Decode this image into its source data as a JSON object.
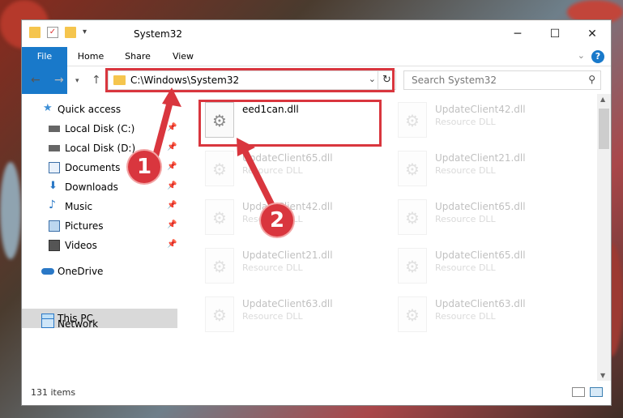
{
  "window": {
    "title": "System32",
    "controls": {
      "minimize": "─",
      "maximize": "☐",
      "close": "✕"
    }
  },
  "ribbon": {
    "tabs": [
      "File",
      "Home",
      "Share",
      "View"
    ],
    "help": "?"
  },
  "address": {
    "path": "C:\\Windows\\System32",
    "search_placeholder": "Search System32"
  },
  "sidebar": {
    "items": [
      {
        "label": "Quick access",
        "icon": "star-icon",
        "pinned": false
      },
      {
        "label": "Local Disk (C:)",
        "icon": "drive-icon",
        "pinned": true
      },
      {
        "label": "Local Disk (D:)",
        "icon": "drive-icon",
        "pinned": true
      },
      {
        "label": "Documents",
        "icon": "documents-icon",
        "pinned": true
      },
      {
        "label": "Downloads",
        "icon": "download-icon",
        "pinned": true
      },
      {
        "label": "Music",
        "icon": "music-icon",
        "pinned": true
      },
      {
        "label": "Pictures",
        "icon": "pictures-icon",
        "pinned": true
      },
      {
        "label": "Videos",
        "icon": "videos-icon",
        "pinned": true
      },
      {
        "label": "OneDrive",
        "icon": "cloud-icon",
        "pinned": false
      },
      {
        "label": "This PC",
        "icon": "computer-icon",
        "pinned": false,
        "selected": true
      },
      {
        "label": "Network",
        "icon": "network-icon",
        "pinned": false
      }
    ]
  },
  "files": [
    {
      "name": "eed1can.dll",
      "type": "",
      "faded": false
    },
    {
      "name": "UpdateClient42.dll",
      "type": "Resource DLL",
      "faded": true
    },
    {
      "name": "UpdateClient65.dll",
      "type": "Resource DLL",
      "faded": true
    },
    {
      "name": "UpdateClient21.dll",
      "type": "Resource DLL",
      "faded": true
    },
    {
      "name": "UpdateClient42.dll",
      "type": "Resource DLL",
      "faded": true
    },
    {
      "name": "UpdateClient65.dll",
      "type": "Resource DLL",
      "faded": true
    },
    {
      "name": "UpdateClient21.dll",
      "type": "Resource DLL",
      "faded": true
    },
    {
      "name": "UpdateClient65.dll",
      "type": "Resource DLL",
      "faded": true
    },
    {
      "name": "UpdateClient63.dll",
      "type": "Resource DLL",
      "faded": true
    },
    {
      "name": "UpdateClient63.dll",
      "type": "Resource DLL",
      "faded": true
    }
  ],
  "status": {
    "item_count": "131 items"
  },
  "annotations": {
    "marker1": "1",
    "marker2": "2"
  },
  "colors": {
    "accent": "#1979ca",
    "highlight": "#d9363e"
  }
}
